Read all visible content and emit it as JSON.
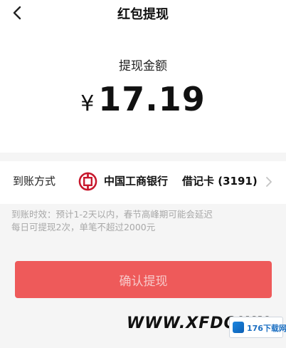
{
  "header": {
    "title": "红包提现",
    "back_icon": "chevron-left-icon"
  },
  "withdraw": {
    "amount_label": "提现金额",
    "currency_symbol": "¥",
    "amount": "17.19"
  },
  "account": {
    "label": "到账方式",
    "bank_icon": "icbc-bank-icon",
    "bank_name": "中国工商银行",
    "card": "借记卡 (3191)",
    "chevron_icon": "chevron-right-icon"
  },
  "notice": {
    "line1": "到账时效：预计1-2天以内，春节高峰期可能会延迟",
    "line2": "每日可提现2次，单笔不超过2000元"
  },
  "confirm_button": {
    "label": "确认提现"
  },
  "watermark": {
    "text": "WWW.XFDOWN",
    "logo_text": "176下载网"
  },
  "colors": {
    "accent": "#ee5a5a",
    "bank_red": "#c7162b"
  }
}
